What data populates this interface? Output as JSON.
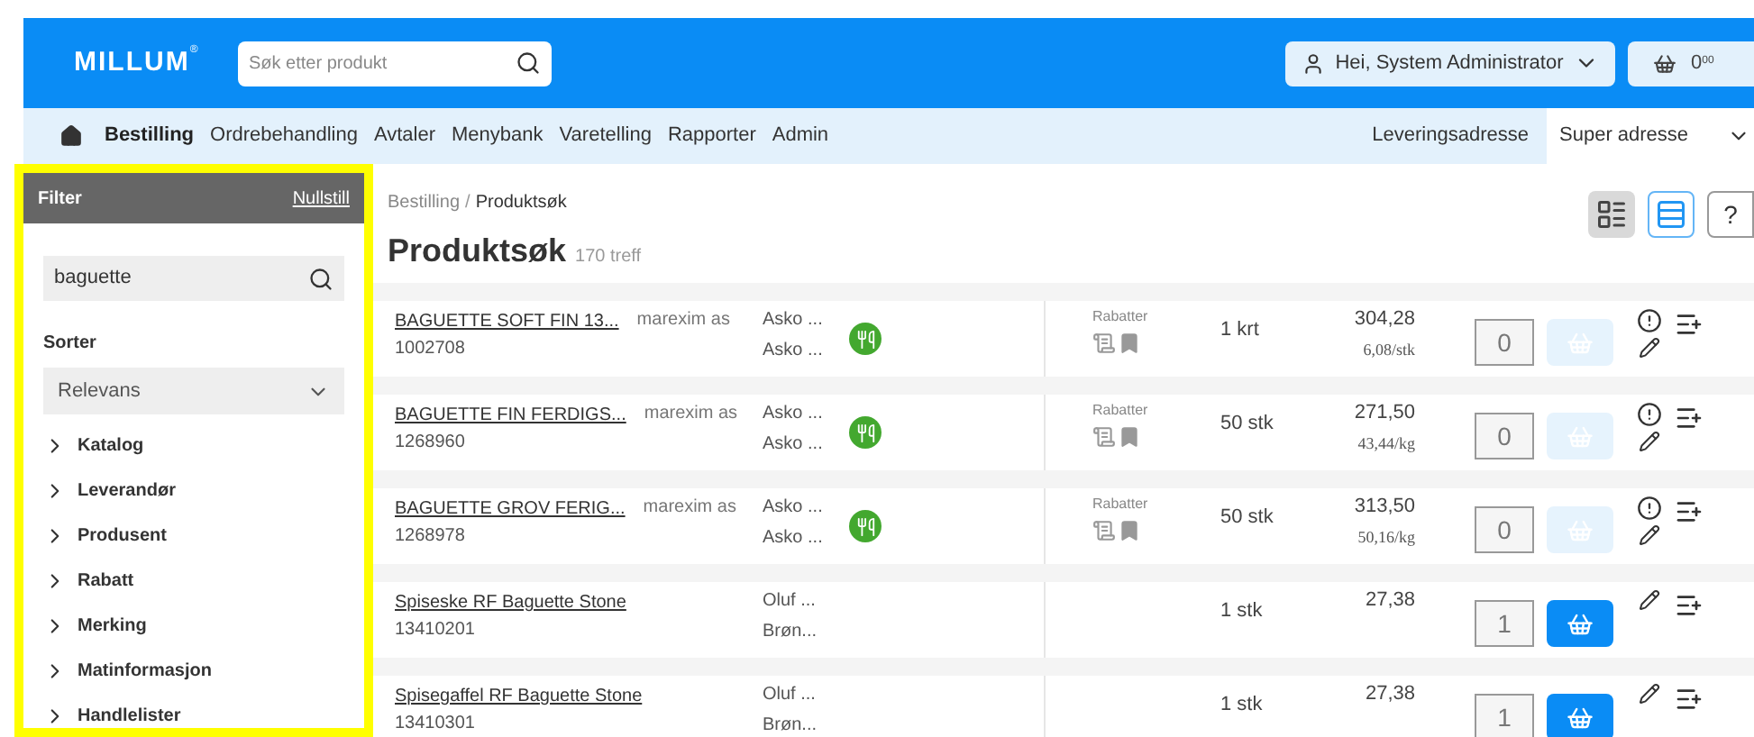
{
  "header": {
    "logo": "MILLUM",
    "logo_mark": "®",
    "search": {
      "placeholder": "Søk etter produkt"
    },
    "user_button": "Hei, System Administrator",
    "cart": {
      "amount": "0",
      "decimals": "00"
    }
  },
  "nav": {
    "items": [
      {
        "label": "Bestilling",
        "selected": true
      },
      {
        "label": "Ordrebehandling",
        "selected": false
      },
      {
        "label": "Avtaler",
        "selected": false
      },
      {
        "label": "Menybank",
        "selected": false
      },
      {
        "label": "Varetelling",
        "selected": false
      },
      {
        "label": "Rapporter",
        "selected": false
      },
      {
        "label": "Admin",
        "selected": false
      }
    ],
    "address_label": "Leveringsadresse",
    "address_value": "Super adresse"
  },
  "filter": {
    "highlighted": true,
    "title": "Filter",
    "reset": "Nullstill",
    "search_value": "baguette",
    "sort_label": "Sorter",
    "sort_value": "Relevans",
    "groups": [
      {
        "label": "Katalog",
        "expanded": false
      },
      {
        "label": "Leverandør",
        "expanded": false
      },
      {
        "label": "Produsent",
        "expanded": false
      },
      {
        "label": "Rabatt",
        "expanded": false
      },
      {
        "label": "Merking",
        "expanded": false
      },
      {
        "label": "Matinformasjon",
        "expanded": false
      },
      {
        "label": "Handlelister",
        "expanded": false
      }
    ]
  },
  "breadcrumb": [
    "Bestilling",
    "Produktsøk"
  ],
  "breadcrumb_separator": "/",
  "page_title": "Produktsøk",
  "hit_count": "170 treff",
  "view_toggle": [
    {
      "kind": "grid",
      "selected": false
    },
    {
      "kind": "list",
      "selected": true
    }
  ],
  "help": "?",
  "products": [
    {
      "name": "BAGUETTE SOFT FIN 13...",
      "number": "1002708",
      "supplier": "marexim as",
      "distributors": [
        "Asko ...",
        "Asko ..."
      ],
      "meal_badge": true,
      "discount_label": "Rabatter",
      "unit": "1 krt",
      "price": "304,28",
      "unit_price": "6,08/stk",
      "quantity": "0",
      "cart_enabled": false,
      "info": true
    },
    {
      "name": "BAGUETTE FIN FERDIGS...",
      "number": "1268960",
      "supplier": "marexim as",
      "distributors": [
        "Asko ...",
        "Asko ..."
      ],
      "meal_badge": true,
      "discount_label": "Rabatter",
      "unit": "50 stk",
      "price": "271,50",
      "unit_price": "43,44/kg",
      "quantity": "0",
      "cart_enabled": false,
      "info": true
    },
    {
      "name": "BAGUETTE GROV FERIG...",
      "number": "1268978",
      "supplier": "marexim as",
      "distributors": [
        "Asko ...",
        "Asko ..."
      ],
      "meal_badge": true,
      "discount_label": "Rabatter",
      "unit": "50 stk",
      "price": "313,50",
      "unit_price": "50,16/kg",
      "quantity": "0",
      "cart_enabled": false,
      "info": true
    },
    {
      "name": "Spiseske RF Baguette Stone",
      "number": "13410201",
      "distributors": [
        "Oluf ...",
        "Brøn..."
      ],
      "meal_badge": false,
      "unit": "1 stk",
      "price": "27,38",
      "quantity": "1",
      "cart_enabled": true,
      "info": false
    },
    {
      "name": "Spisegaffel RF Baguette Stone",
      "number": "13410301",
      "distributors": [
        "Oluf ...",
        "Brøn..."
      ],
      "meal_badge": false,
      "unit": "1 stk",
      "price": "27,38",
      "quantity": "1",
      "cart_enabled": true,
      "info": false
    }
  ]
}
